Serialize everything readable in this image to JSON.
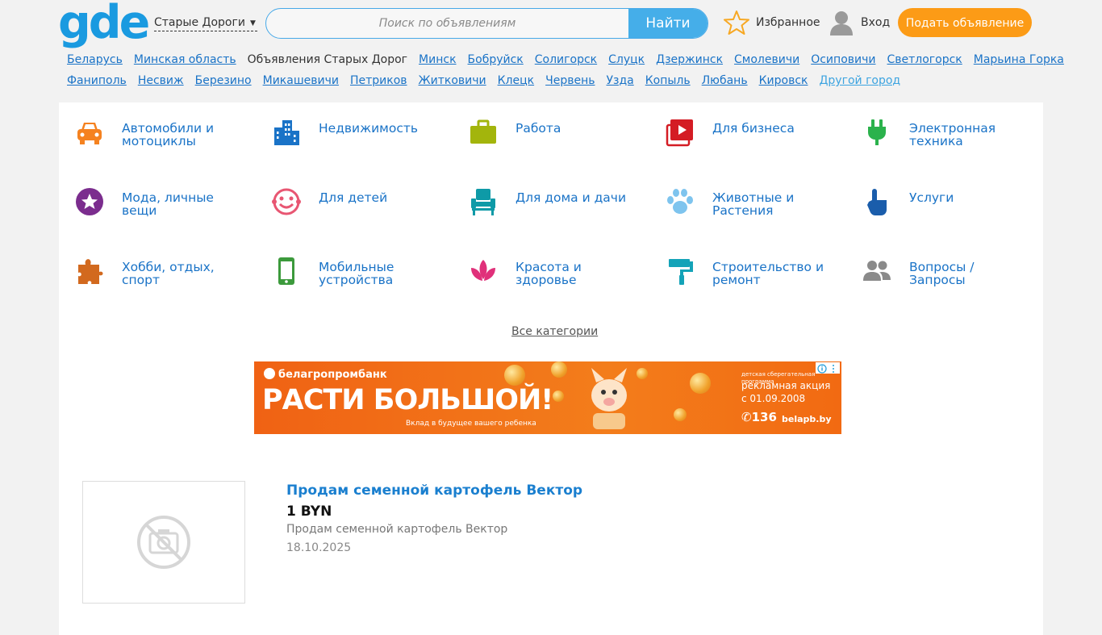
{
  "header": {
    "logo": "gde",
    "city": "Старые Дороги",
    "search_placeholder": "Поиск по объявлениям",
    "search_button": "Найти",
    "favorites": "Избранное",
    "login": "Вход",
    "post_ad": "Подать объявление"
  },
  "cities_row1": [
    {
      "label": "Беларусь",
      "type": "link"
    },
    {
      "label": "Минская область",
      "type": "link"
    },
    {
      "label": "Объявления Старых Дорог",
      "type": "current"
    },
    {
      "label": "Минск",
      "type": "link"
    },
    {
      "label": "Бобруйск",
      "type": "link"
    },
    {
      "label": "Солигорск",
      "type": "link"
    },
    {
      "label": "Слуцк",
      "type": "link"
    },
    {
      "label": "Дзержинск",
      "type": "link"
    },
    {
      "label": "Смолевичи",
      "type": "link"
    },
    {
      "label": "Осиповичи",
      "type": "link"
    },
    {
      "label": "Светлогорск",
      "type": "link"
    },
    {
      "label": "Марьина Горка",
      "type": "link"
    }
  ],
  "cities_row2": [
    {
      "label": "Фаниполь",
      "type": "link"
    },
    {
      "label": "Несвиж",
      "type": "link"
    },
    {
      "label": "Березино",
      "type": "link"
    },
    {
      "label": "Микашевичи",
      "type": "link"
    },
    {
      "label": "Петриков",
      "type": "link"
    },
    {
      "label": "Житковичи",
      "type": "link"
    },
    {
      "label": "Клецк",
      "type": "link"
    },
    {
      "label": "Червень",
      "type": "link"
    },
    {
      "label": "Узда",
      "type": "link"
    },
    {
      "label": "Копыль",
      "type": "link"
    },
    {
      "label": "Любань",
      "type": "link"
    },
    {
      "label": "Кировск",
      "type": "link"
    },
    {
      "label": "Другой город",
      "type": "other"
    }
  ],
  "categories": [
    {
      "label": "Автомобили и мотоциклы",
      "icon": "car-icon",
      "color": "#f58220"
    },
    {
      "label": "Недвижимость",
      "icon": "buildings-icon",
      "color": "#1a73c7"
    },
    {
      "label": "Работа",
      "icon": "briefcase-icon",
      "color": "#a3b50c"
    },
    {
      "label": "Для бизнеса",
      "icon": "video-play-icon",
      "color": "#d41c24"
    },
    {
      "label": "Электронная техника",
      "icon": "plug-icon",
      "color": "#2bb24c"
    },
    {
      "label": "Мода, личные вещи",
      "icon": "star-circle-icon",
      "color": "#7b2d8e"
    },
    {
      "label": "Для детей",
      "icon": "smiley-icon",
      "color": "#e85672"
    },
    {
      "label": "Для дома и дачи",
      "icon": "armchair-icon",
      "color": "#0e9aa7"
    },
    {
      "label": "Животные и Растения",
      "icon": "paw-icon",
      "color": "#7ec4ee"
    },
    {
      "label": "Услуги",
      "icon": "hand-pointer-icon",
      "color": "#1a5dab"
    },
    {
      "label": "Хобби, отдых, спорт",
      "icon": "puzzle-icon",
      "color": "#d2691e"
    },
    {
      "label": "Мобильные устройства",
      "icon": "smartphone-icon",
      "color": "#3c9a3c"
    },
    {
      "label": "Красота и здоровье",
      "icon": "lotus-icon",
      "color": "#e0307a"
    },
    {
      "label": "Строительство и ремонт",
      "icon": "paint-roller-icon",
      "color": "#14a3b8"
    },
    {
      "label": "Вопросы / Запросы",
      "icon": "users-icon",
      "color": "#8a8a8a"
    }
  ],
  "all_categories": "Все категории",
  "ad": {
    "brand": "белагропромбанк",
    "headline": "РАСТИ БОЛЬШОЙ!",
    "subline": "Вклад в будущее вашего ребенка",
    "promo_small": "детская сберегательная программа",
    "promo": "рекламная акция с 01.09.2008",
    "phone": "136",
    "site": "belapb.by"
  },
  "listing": {
    "title": "Продам семенной картофель Вектор",
    "price": "1 BYN",
    "description": "Продам семенной картофель Вектор",
    "date": "18.10.2025"
  }
}
